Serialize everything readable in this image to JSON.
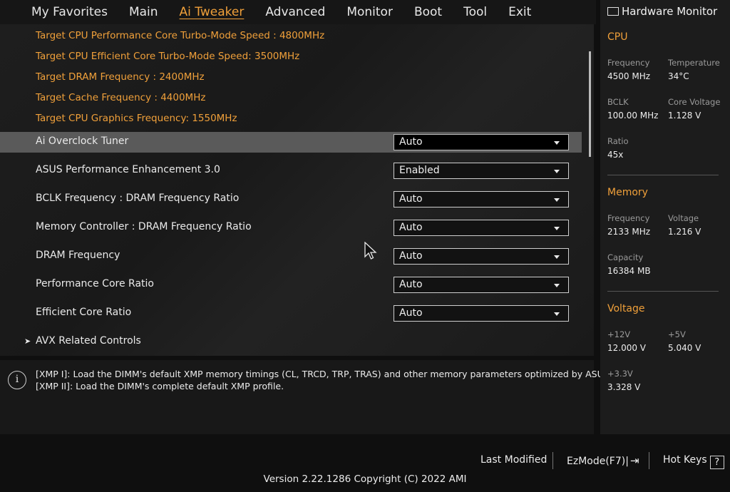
{
  "nav": {
    "tabs": [
      {
        "label": "My Favorites"
      },
      {
        "label": "Main"
      },
      {
        "label": "Ai Tweaker"
      },
      {
        "label": "Advanced"
      },
      {
        "label": "Monitor"
      },
      {
        "label": "Boot"
      },
      {
        "label": "Tool"
      },
      {
        "label": "Exit"
      }
    ],
    "active": "Ai Tweaker"
  },
  "targets": [
    "Target CPU Performance Core Turbo-Mode Speed : 4800MHz",
    "Target CPU Efficient Core Turbo-Mode Speed: 3500MHz",
    "Target DRAM Frequency : 2400MHz",
    "Target Cache Frequency : 4400MHz",
    "Target CPU Graphics Frequency: 1550MHz"
  ],
  "settings": [
    {
      "label": "Ai Overclock Tuner",
      "value": "Auto",
      "selected": true
    },
    {
      "label": "ASUS Performance Enhancement 3.0",
      "value": "Enabled"
    },
    {
      "label": "BCLK Frequency : DRAM Frequency Ratio",
      "value": "Auto"
    },
    {
      "label": "Memory Controller : DRAM Frequency Ratio",
      "value": "Auto"
    },
    {
      "label": "DRAM Frequency",
      "value": "Auto"
    },
    {
      "label": "Performance Core Ratio",
      "value": "Auto"
    },
    {
      "label": "Efficient Core Ratio",
      "value": "Auto"
    }
  ],
  "submenu": {
    "label": "AVX Related Controls"
  },
  "help": {
    "line1": "[XMP I]:  Load the DIMM's default XMP memory timings (CL, TRCD, TRP, TRAS) and other memory parameters optimized by ASUS.",
    "line2": "[XMP II]:  Load the DIMM's complete default XMP profile.",
    "icon_text": "i"
  },
  "hw_monitor": {
    "title": "Hardware Monitor",
    "cpu": {
      "section": "CPU",
      "frequency_label": "Frequency",
      "frequency": "4500 MHz",
      "temperature_label": "Temperature",
      "temperature": "34°C",
      "bclk_label": "BCLK",
      "bclk": "100.00 MHz",
      "core_voltage_label": "Core Voltage",
      "core_voltage": "1.128 V",
      "ratio_label": "Ratio",
      "ratio": "45x"
    },
    "memory": {
      "section": "Memory",
      "frequency_label": "Frequency",
      "frequency": "2133 MHz",
      "voltage_label": "Voltage",
      "voltage": "1.216 V",
      "capacity_label": "Capacity",
      "capacity": "16384 MB"
    },
    "voltage": {
      "section": "Voltage",
      "v12_label": "+12V",
      "v12": "12.000 V",
      "v5_label": "+5V",
      "v5": "5.040 V",
      "v33_label": "+3.3V",
      "v33": "3.328 V"
    }
  },
  "footer": {
    "last_modified": "Last Modified",
    "ezmode": "EzMode(F7)|",
    "hot_keys": "Hot Keys",
    "hot_keys_icon": "?",
    "version": "Version 2.22.1286 Copyright (C) 2022 AMI"
  },
  "colors": {
    "accent": "#f0a03a",
    "selected_row": "#5a5a5a"
  }
}
